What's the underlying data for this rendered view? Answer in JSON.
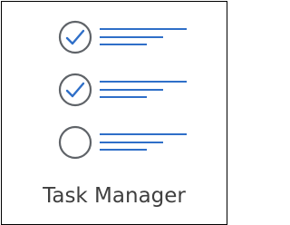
{
  "app_tile": {
    "label": "Task Manager",
    "icon": "task-list-icon",
    "items": [
      {
        "name": "task-item-1",
        "status": "checked"
      },
      {
        "name": "task-item-2",
        "status": "checked"
      },
      {
        "name": "task-item-3",
        "status": "unchecked"
      }
    ]
  },
  "colors": {
    "circle": "#5f6368",
    "check": "#2f6fc8",
    "lines": "#2f6fc8",
    "label": "#3f3f3f",
    "border": "#000000",
    "background": "#ffffff"
  }
}
